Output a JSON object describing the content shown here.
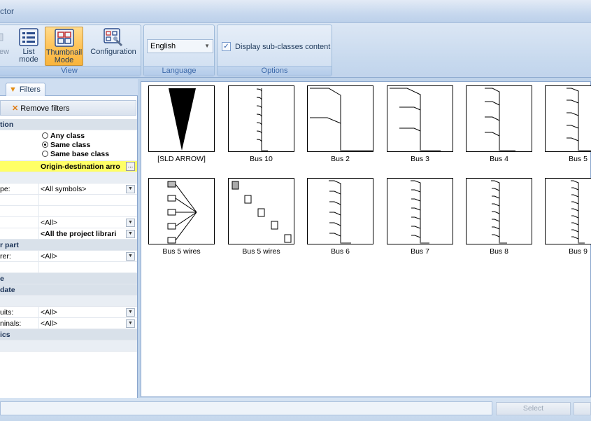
{
  "window": {
    "title": "ctor"
  },
  "ribbon": {
    "view_group": {
      "partial_button": "ew",
      "list_mode": "List mode",
      "thumbnail_mode": "Thumbnail Mode",
      "configuration": "Configuration",
      "name": "View"
    },
    "language_group": {
      "selected": "English",
      "name": "Language"
    },
    "options_group": {
      "display_subclasses": "Display sub-classes content",
      "checked": true,
      "name": "Options"
    }
  },
  "left_panel": {
    "tab": "Filters",
    "remove_filters": "Remove filters",
    "rows": {
      "r1_label": "tion",
      "radio_any": "Any class",
      "radio_same": "Same class",
      "radio_base": "Same base class",
      "origin_dest": "Origin-destination arro",
      "ellipsis": "...",
      "type_label": "pe:",
      "type_value": "<All symbols>",
      "all_value": "<All>",
      "libraries_value": "<All the project librari",
      "part_label": "r part",
      "rer_label": "rer:",
      "rer_value": "<All>",
      "e_label": "e",
      "date_label": "date",
      "uits_label": "uits:",
      "uits_value": "<All>",
      "ninals_label": "ninals:",
      "ninals_value": "<All>",
      "ics_label": "ics"
    }
  },
  "thumbnails": [
    {
      "label": "[SLD ARROW]"
    },
    {
      "label": "Bus 10"
    },
    {
      "label": "Bus 2"
    },
    {
      "label": "Bus 3"
    },
    {
      "label": "Bus 4"
    },
    {
      "label": "Bus 5"
    },
    {
      "label": "Bus 5 wires"
    },
    {
      "label": "Bus 5 wires"
    },
    {
      "label": "Bus 6"
    },
    {
      "label": "Bus 7"
    },
    {
      "label": "Bus 8"
    },
    {
      "label": "Bus 9"
    }
  ],
  "footer": {
    "select_button": "Select"
  }
}
